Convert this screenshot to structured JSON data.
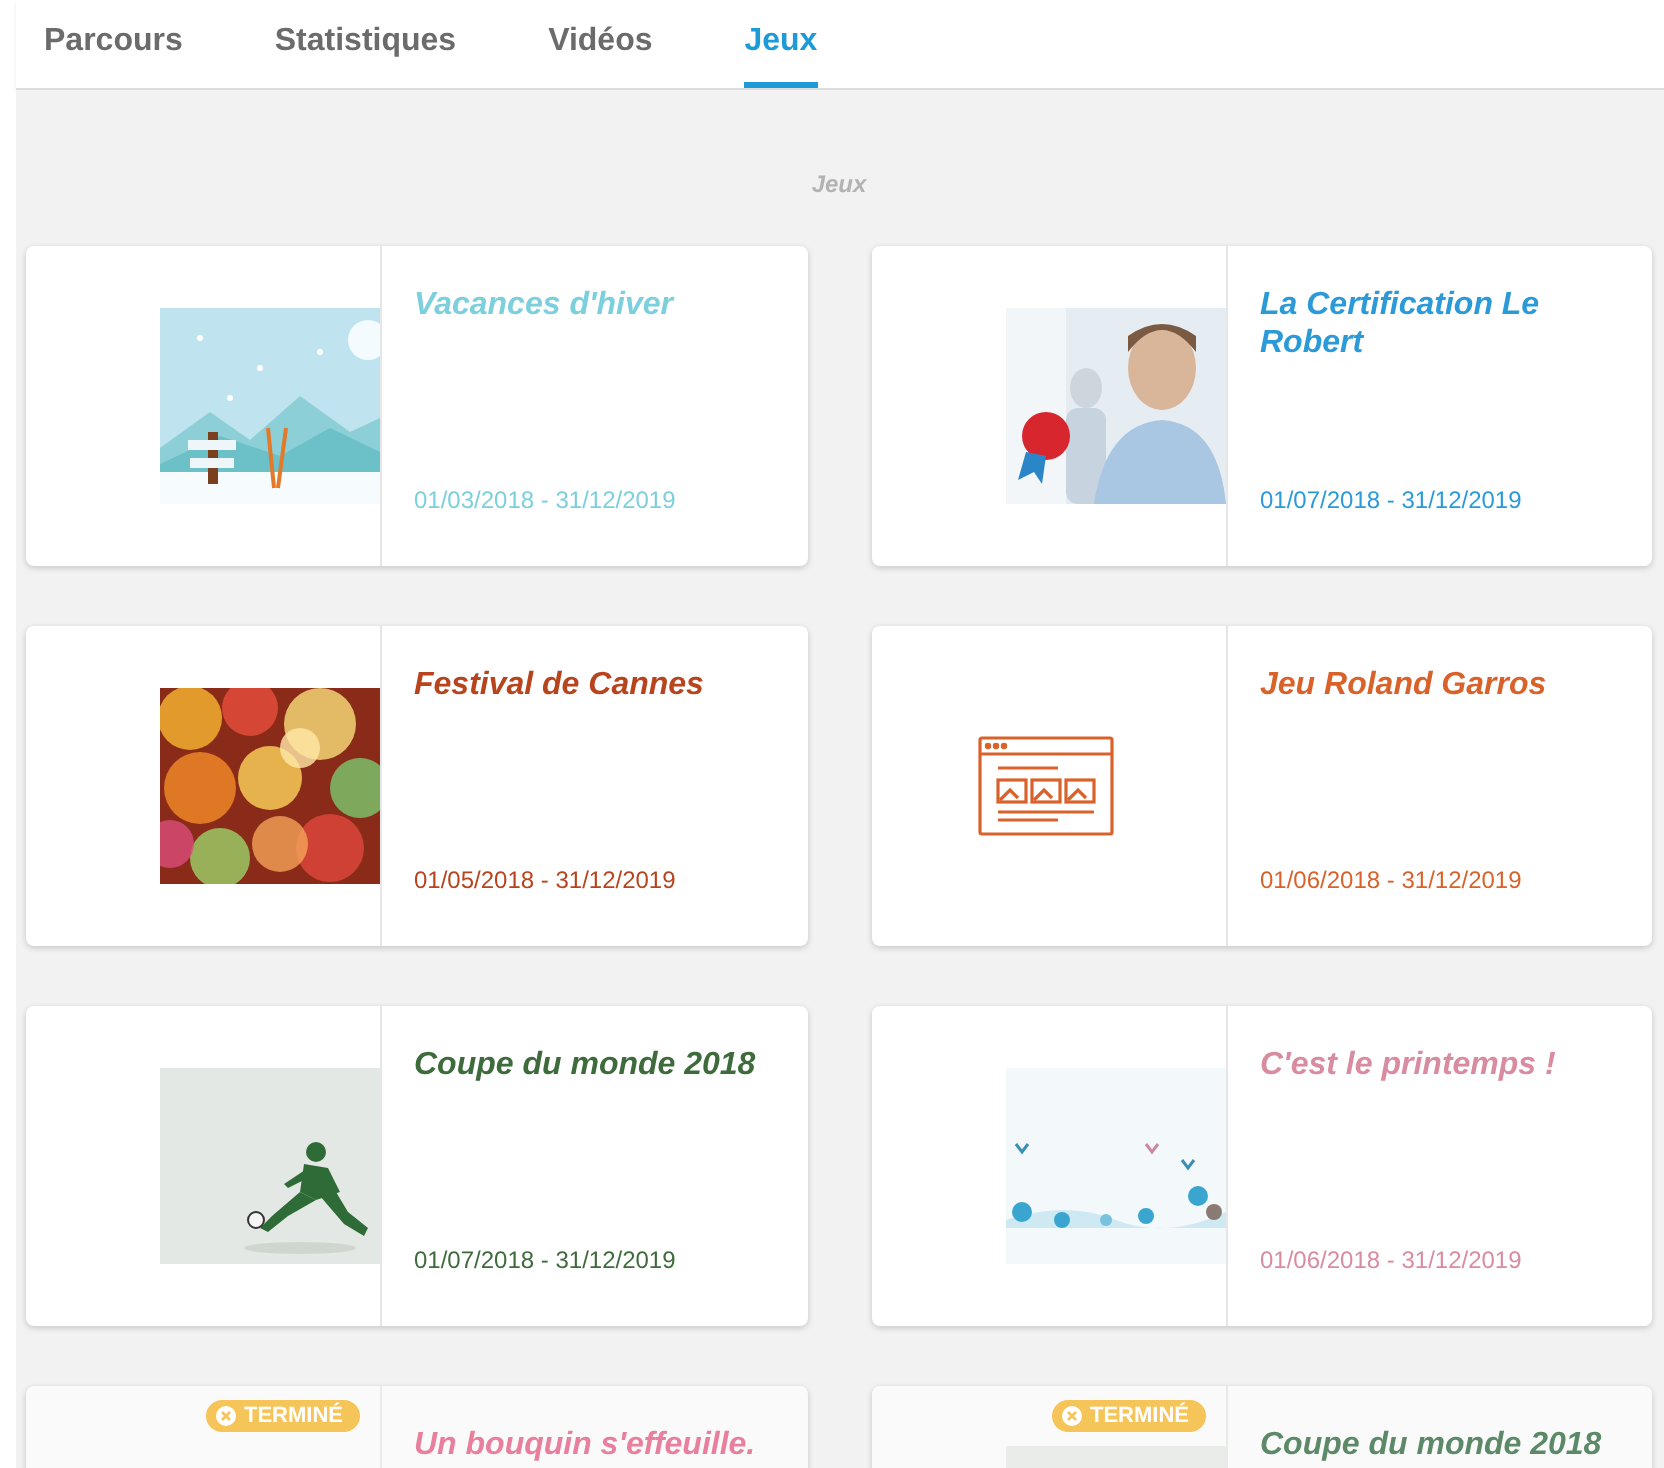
{
  "tabs": [
    {
      "label": "Parcours",
      "selected": false
    },
    {
      "label": "Statistiques",
      "selected": false
    },
    {
      "label": "Vidéos",
      "selected": false
    },
    {
      "label": "Jeux",
      "selected": true
    }
  ],
  "section_title": "Jeux",
  "games": [
    {
      "title": "Vacances d'hiver",
      "dates": "01/03/2018 - 31/12/2019",
      "color": "#7ccfdc",
      "finished": false
    },
    {
      "title": "La Certification Le Robert",
      "dates": "01/07/2018 - 31/12/2019",
      "color": "#2b9ad8",
      "finished": false
    },
    {
      "title": "Festival de Cannes",
      "dates": "01/05/2018 - 31/12/2019",
      "color": "#b8441d",
      "finished": false
    },
    {
      "title": "Jeu Roland Garros",
      "dates": "01/06/2018 - 31/12/2019",
      "color": "#d9622b",
      "image": {
        "kind": "icon"
      },
      "finished": false
    },
    {
      "title": "Coupe du monde 2018",
      "dates": "01/07/2018 - 31/12/2019",
      "color": "#3e6b3c",
      "finished": false
    },
    {
      "title": "C'est le printemps !",
      "dates": "01/06/2018 - 31/12/2019",
      "color": "#d98ba0",
      "finished": false
    },
    {
      "title": "Un bouquin s'effeuille.",
      "color": "#e87f9c",
      "finished": true,
      "badge": "TERMINÉ"
    },
    {
      "title": "Coupe du monde 2018",
      "color": "#5c8a68",
      "finished": true,
      "badge": "TERMINÉ"
    }
  ]
}
